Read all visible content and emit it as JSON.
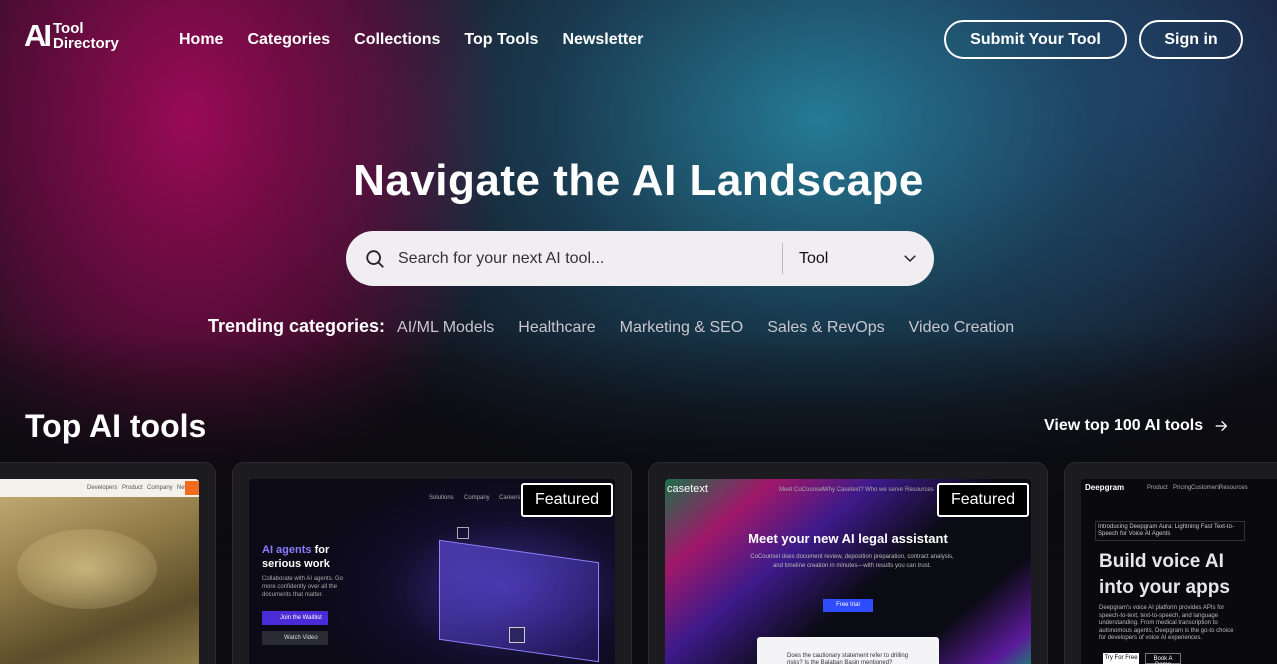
{
  "header": {
    "logo_mark": "AI",
    "logo_line1": "Tool",
    "logo_line2": "Directory",
    "nav": [
      "Home",
      "Categories",
      "Collections",
      "Top Tools",
      "Newsletter"
    ],
    "submit_label": "Submit Your Tool",
    "signin_label": "Sign in"
  },
  "hero": {
    "title": "Navigate the AI Landscape",
    "search_placeholder": "Search for your next AI tool...",
    "search_type": "Tool",
    "trending_label": "Trending categories:",
    "trending": [
      "AI/ML Models",
      "Healthcare",
      "Marketing & SEO",
      "Sales & RevOps",
      "Video Creation"
    ]
  },
  "section": {
    "title": "Top AI tools",
    "view_all": "View top 100 AI tools"
  },
  "cards": [
    {
      "featured": false,
      "shot": {
        "nav": [
          "Developers",
          "Product",
          "Company",
          "News"
        ]
      }
    },
    {
      "featured": true,
      "badge": "Featured",
      "shot": {
        "heading1": "AI agents",
        "heading2": "for",
        "heading3": "serious work",
        "desc": "Collaborate with AI agents. Go more confidently over all the documents that matter.",
        "btn1": "Join the Waitlist",
        "btn2": "Watch Video",
        "nav": [
          "Solutions",
          "Company",
          "Careers"
        ]
      }
    },
    {
      "featured": true,
      "badge": "Featured",
      "shot": {
        "brand": "casetext",
        "heading": "Meet your new AI legal assistant",
        "desc": "CoCounsel does document review, deposition preparation, contract analysis, and timeline creation in minutes—with results you can trust.",
        "btn": "Free trial",
        "nav": [
          "Meet CoCounsel",
          "Why Casetext?",
          "Who we serve",
          "Resources"
        ],
        "question": "Does the cautionary statement refer to drilling risks? Is the Balaban Basin mentioned?"
      }
    },
    {
      "featured": false,
      "shot": {
        "brand": "Deepgram",
        "nav": [
          "Product",
          "Pricing",
          "Customers",
          "Resources"
        ],
        "pill": "Introducing Deepgram Aura: Lightning Fast Text-to-Speech for Voice AI Agents",
        "heading1": "Build voice AI",
        "heading2": "into your apps",
        "desc": "Deepgram's voice AI platform provides APIs for speech-to-text, text-to-speech, and language understanding. From medical transcription to autonomous agents, Deepgram is the go-to choice for developers of voice AI experiences.",
        "btn1": "Try For Free",
        "btn2": "Book A Demo"
      }
    }
  ],
  "colors": {
    "accent_purple": "#4a2bd8",
    "magenta": "#a00a5a",
    "teal": "#288caa"
  }
}
